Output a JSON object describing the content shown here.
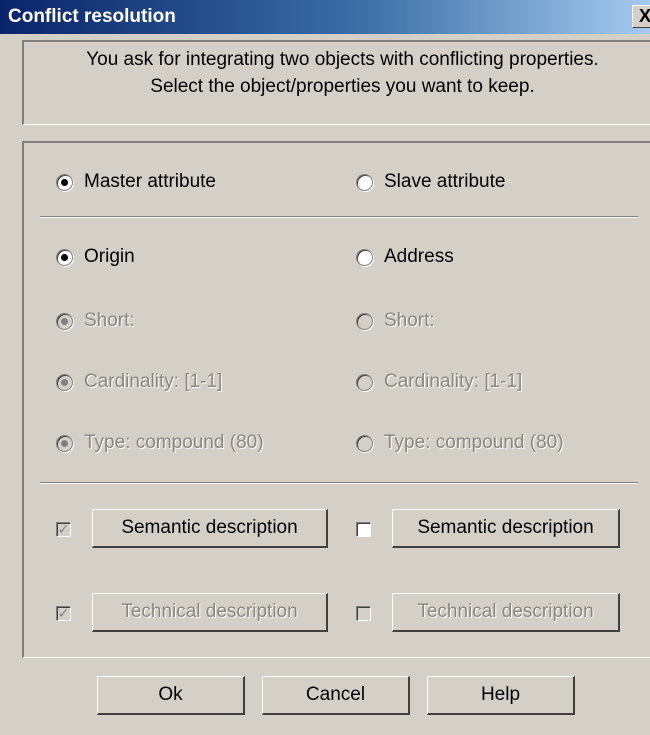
{
  "window": {
    "title": "Conflict resolution",
    "close_glyph": "X"
  },
  "prompt": {
    "line1": "You ask for integrating two objects with conflicting properties.",
    "line2": "Select the object/properties you want to keep."
  },
  "choices": {
    "master": {
      "label": "Master attribute",
      "selected": true
    },
    "slave": {
      "label": "Slave attribute",
      "selected": false
    },
    "origin": {
      "label": "Origin",
      "selected": true
    },
    "address": {
      "label": "Address",
      "selected": false
    },
    "left_short": {
      "label": "Short:",
      "selected": true,
      "enabled": false
    },
    "right_short": {
      "label": "Short:",
      "selected": false,
      "enabled": false
    },
    "left_cardinality": {
      "label": "Cardinality: [1-1]",
      "selected": true,
      "enabled": false
    },
    "right_cardinality": {
      "label": "Cardinality: [1-1]",
      "selected": false,
      "enabled": false
    },
    "left_type": {
      "label": "Type: compound (80)",
      "selected": true,
      "enabled": false
    },
    "right_type": {
      "label": "Type: compound (80)",
      "selected": false,
      "enabled": false
    }
  },
  "descriptions": {
    "left_semantic": {
      "label": "Semantic description",
      "checked": true,
      "check_enabled": false
    },
    "right_semantic": {
      "label": "Semantic description",
      "checked": false,
      "check_enabled": true
    },
    "left_technical": {
      "label": "Technical description",
      "checked": true,
      "enabled": false
    },
    "right_technical": {
      "label": "Technical description",
      "checked": false,
      "enabled": false
    }
  },
  "footer": {
    "ok": "Ok",
    "cancel": "Cancel",
    "help": "Help"
  }
}
